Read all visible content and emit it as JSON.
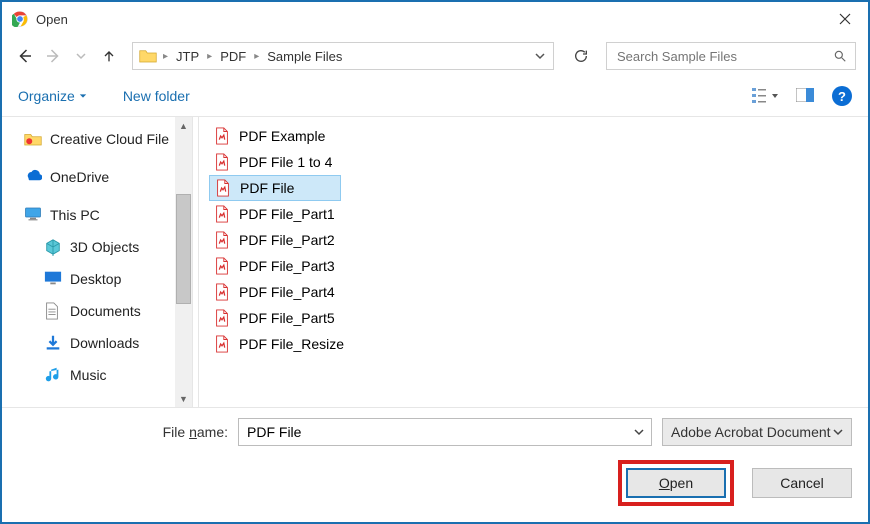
{
  "title": "Open",
  "breadcrumbs": [
    "JTP",
    "PDF",
    "Sample Files"
  ],
  "search": {
    "placeholder": "Search Sample Files"
  },
  "toolbar": {
    "organize": "Organize",
    "new_folder": "New folder"
  },
  "sidebar": {
    "items": [
      {
        "label": "Creative Cloud File",
        "icon": "cc"
      },
      {
        "label": "OneDrive",
        "icon": "onedrive"
      },
      {
        "label": "This PC",
        "icon": "pc"
      },
      {
        "label": "3D Objects",
        "icon": "3d",
        "sub": true
      },
      {
        "label": "Desktop",
        "icon": "desktop",
        "sub": true
      },
      {
        "label": "Documents",
        "icon": "documents",
        "sub": true
      },
      {
        "label": "Downloads",
        "icon": "downloads",
        "sub": true
      },
      {
        "label": "Music",
        "icon": "music",
        "sub": true
      }
    ]
  },
  "files": [
    {
      "name": "PDF Example",
      "selected": false
    },
    {
      "name": "PDF File 1 to 4",
      "selected": false
    },
    {
      "name": "PDF File",
      "selected": true
    },
    {
      "name": "PDF File_Part1",
      "selected": false
    },
    {
      "name": "PDF File_Part2",
      "selected": false
    },
    {
      "name": "PDF File_Part3",
      "selected": false
    },
    {
      "name": "PDF File_Part4",
      "selected": false
    },
    {
      "name": "PDF File_Part5",
      "selected": false
    },
    {
      "name": "PDF File_Resize",
      "selected": false
    }
  ],
  "footer": {
    "filename_label_pre": "File ",
    "filename_label_ul": "n",
    "filename_label_post": "ame:",
    "filename_value": "PDF File",
    "filter": "Adobe Acrobat Document",
    "open_ul": "O",
    "open_post": "pen",
    "cancel": "Cancel"
  }
}
